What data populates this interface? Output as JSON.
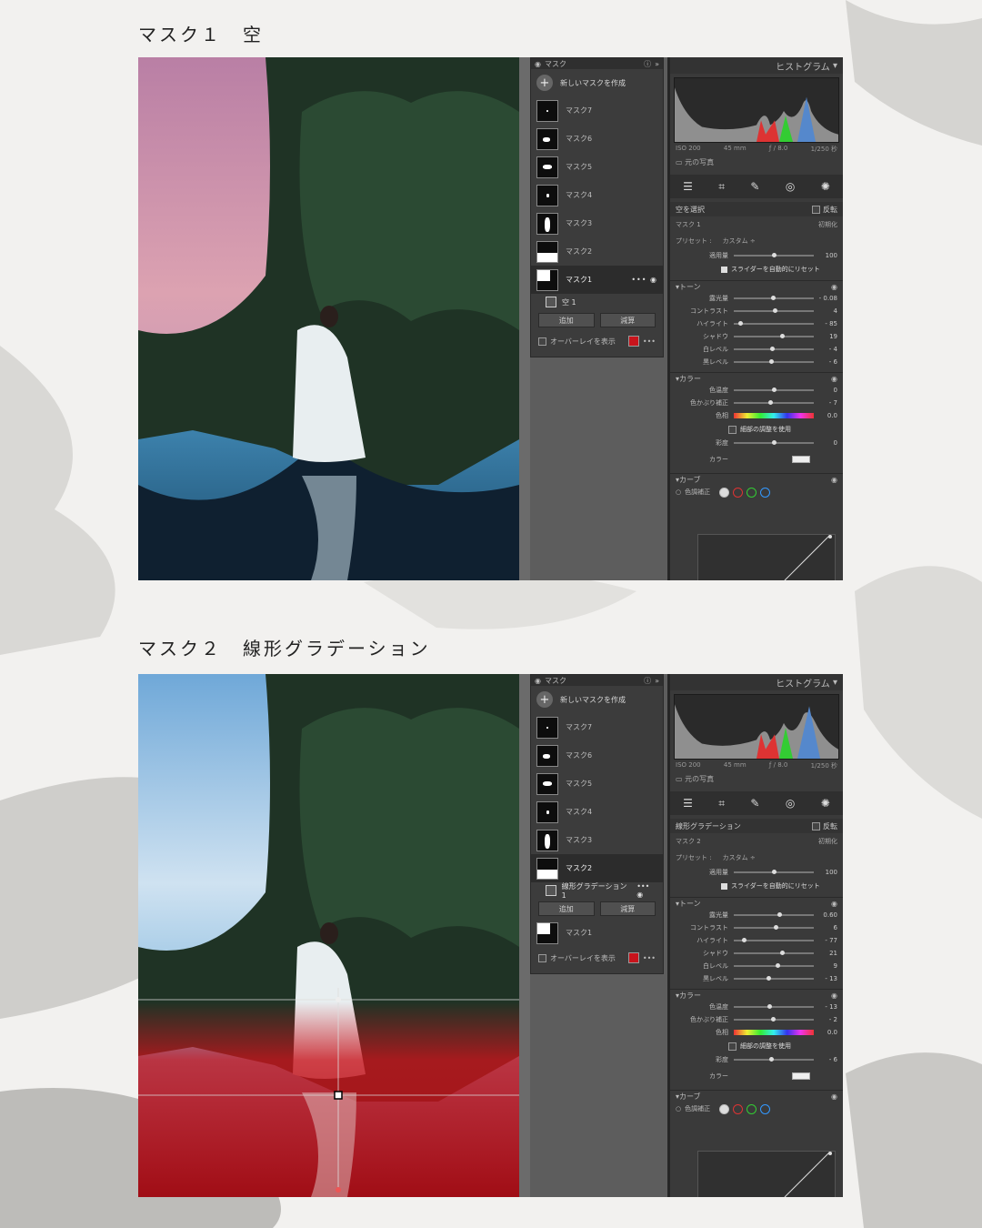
{
  "sections": [
    {
      "title": "マスク１　空",
      "mask_panel": {
        "header": "マスク",
        "new_mask": "新しいマスクを作成",
        "masks": [
          "マスク7",
          "マスク6",
          "マスク5",
          "マスク4",
          "マスク3",
          "マスク2",
          "マスク1"
        ],
        "active_mask": "マスク1",
        "sub_item": "空 1",
        "add": "追加",
        "subtract": "減算",
        "overlay": "オーバーレイを表示"
      },
      "right_panel": {
        "histogram": "ヒストグラム",
        "exif": [
          "ISO 200",
          "45 mm",
          "ƒ / 8.0",
          "1/250 秒"
        ],
        "original_photo": "元の写真",
        "selection_label": "空を選択",
        "invert": "反転",
        "mask_name": "マスク 1",
        "reset": "初期化",
        "preset_label": "プリセット :",
        "preset_value": "カスタム ÷",
        "amount_label": "適用量",
        "amount_value": "100",
        "auto_reset": "スライダーを自動的にリセット",
        "tone_label": "トーン",
        "tone_sliders": [
          {
            "label": "露光量",
            "value": "- 0.08",
            "pos": 0.49
          },
          {
            "label": "コントラスト",
            "value": "4",
            "pos": 0.51
          },
          {
            "label": "ハイライト",
            "value": "- 85",
            "pos": 0.08
          },
          {
            "label": "シャドウ",
            "value": "19",
            "pos": 0.6
          },
          {
            "label": "白レベル",
            "value": "- 4",
            "pos": 0.48
          },
          {
            "label": "黒レベル",
            "value": "- 6",
            "pos": 0.47
          }
        ],
        "color_label": "カラー",
        "color_sliders": [
          {
            "label": "色温度",
            "value": "0",
            "pos": 0.5
          },
          {
            "label": "色かぶり補正",
            "value": "- 7",
            "pos": 0.46
          }
        ],
        "hue_label": "色相",
        "hue_value": "0.0",
        "fine_adjust": "細部の調整を使用",
        "saturation_label": "彩度",
        "saturation_value": "0",
        "saturation_pos": 0.5,
        "color_swatch_label": "カラー",
        "curve_label": "カーブ",
        "tone_correction": "色調補正"
      }
    },
    {
      "title": "マスク２　線形グラデーション",
      "mask_panel": {
        "header": "マスク",
        "new_mask": "新しいマスクを作成",
        "masks": [
          "マスク7",
          "マスク6",
          "マスク5",
          "マスク4",
          "マスク3",
          "マスク2",
          "マスク1"
        ],
        "active_mask": "マスク2",
        "sub_item": "線形グラデーション 1",
        "add": "追加",
        "subtract": "減算",
        "overlay": "オーバーレイを表示"
      },
      "right_panel": {
        "histogram": "ヒストグラム",
        "exif": [
          "ISO 200",
          "45 mm",
          "ƒ / 8.0",
          "1/250 秒"
        ],
        "original_photo": "元の写真",
        "selection_label": "線形グラデーション",
        "invert": "反転",
        "mask_name": "マスク 2",
        "reset": "初期化",
        "preset_label": "プリセット :",
        "preset_value": "カスタム ÷",
        "amount_label": "適用量",
        "amount_value": "100",
        "auto_reset": "スライダーを自動的にリセット",
        "tone_label": "トーン",
        "tone_sliders": [
          {
            "label": "露光量",
            "value": "0.60",
            "pos": 0.57
          },
          {
            "label": "コントラスト",
            "value": "6",
            "pos": 0.52
          },
          {
            "label": "ハイライト",
            "value": "- 77",
            "pos": 0.12
          },
          {
            "label": "シャドウ",
            "value": "21",
            "pos": 0.6
          },
          {
            "label": "白レベル",
            "value": "9",
            "pos": 0.54
          },
          {
            "label": "黒レベル",
            "value": "- 13",
            "pos": 0.43
          }
        ],
        "color_label": "カラー",
        "color_sliders": [
          {
            "label": "色温度",
            "value": "- 13",
            "pos": 0.44
          },
          {
            "label": "色かぶり補正",
            "value": "- 2",
            "pos": 0.49
          }
        ],
        "hue_label": "色相",
        "hue_value": "0.0",
        "fine_adjust": "細部の調整を使用",
        "saturation_label": "彩度",
        "saturation_value": "- 6",
        "saturation_pos": 0.47,
        "color_swatch_label": "カラー",
        "curve_label": "カーブ",
        "tone_correction": "色調補正"
      }
    }
  ],
  "colors": {
    "overlay_red": "#c8141c",
    "sky_pink": "#d7a0b4",
    "sky_blue": "#9cc7e8",
    "water_blue": "#3f8fbf"
  }
}
